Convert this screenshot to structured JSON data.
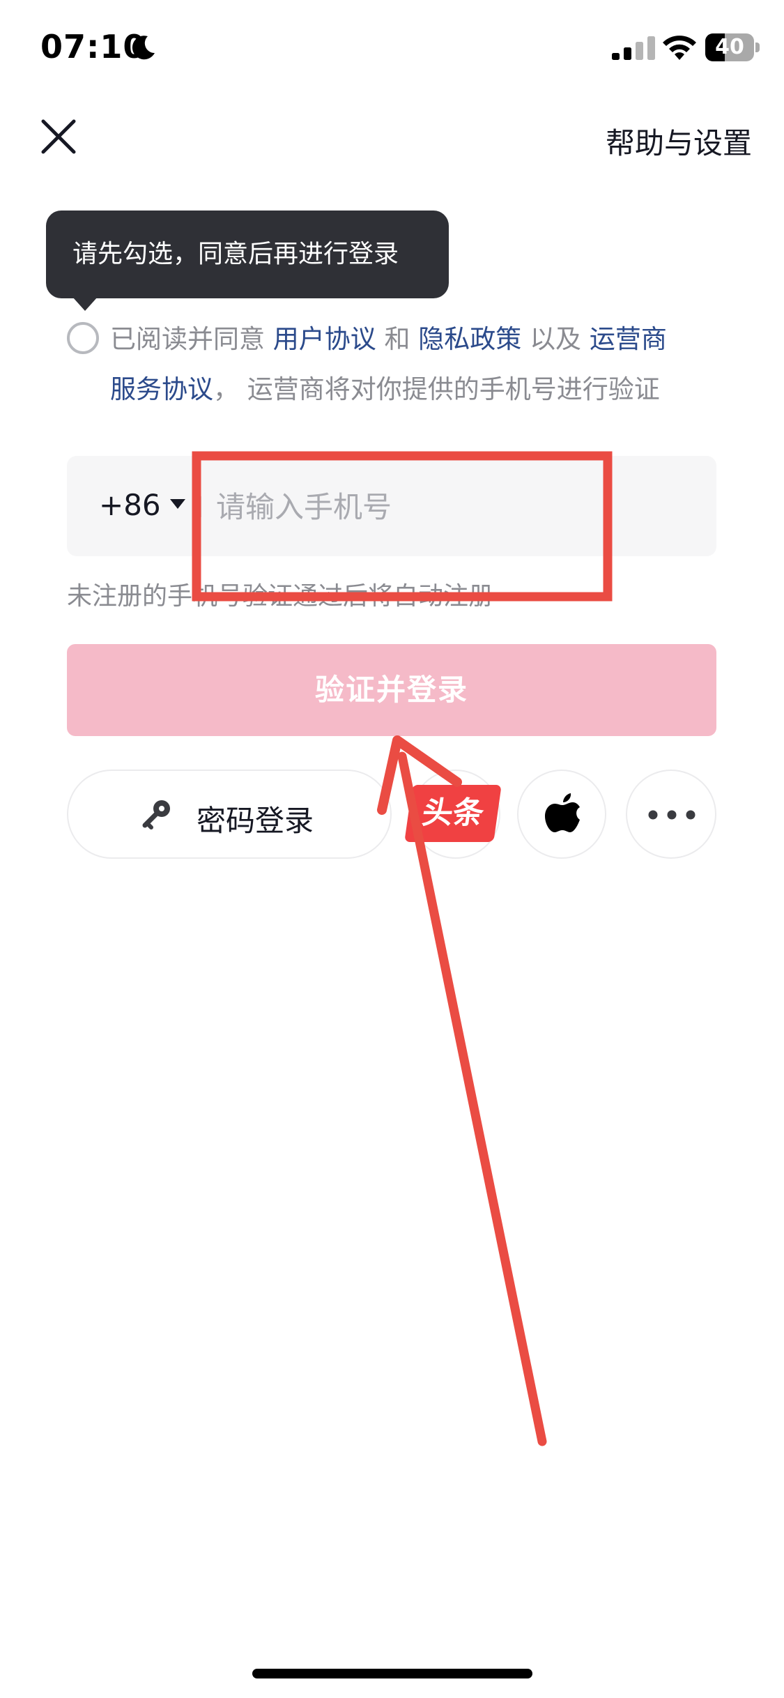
{
  "status_bar": {
    "time": "07:10",
    "battery_percent": "40",
    "battery_level": 0.4,
    "icons": [
      "moon-icon",
      "signal-icon",
      "wifi-icon",
      "battery-icon"
    ]
  },
  "header": {
    "close_icon": "close-icon",
    "help_label": "帮助与设置"
  },
  "tooltip": {
    "text": "请先勾选，同意后再进行登录"
  },
  "agreement": {
    "prefix": "已阅读并同意",
    "user_agreement": "用户协议",
    "and": "和",
    "privacy_policy": "隐私政策",
    "and_also": "以及",
    "carrier_terms_part1": "运营商",
    "carrier_terms_part2": "服务协议",
    "separator": "，",
    "suffix": "运营商将对你提供的手机号进行验证"
  },
  "phone": {
    "country_code": "+86",
    "placeholder": "请输入手机号",
    "value": ""
  },
  "register_hint": "未注册的手机号验证通过后将自动注册",
  "primary_button": {
    "label": "验证并登录"
  },
  "alt_login": {
    "password_label": "密码登录",
    "toutiao_label": "头条",
    "icons": [
      "key-icon",
      "toutiao-icon",
      "apple-icon",
      "more-icon"
    ]
  },
  "colors": {
    "primary_disabled": "#f5bac8",
    "link": "#2b4a8b",
    "annotation": "#ea4c43",
    "tooltip_bg": "#2f3036"
  }
}
